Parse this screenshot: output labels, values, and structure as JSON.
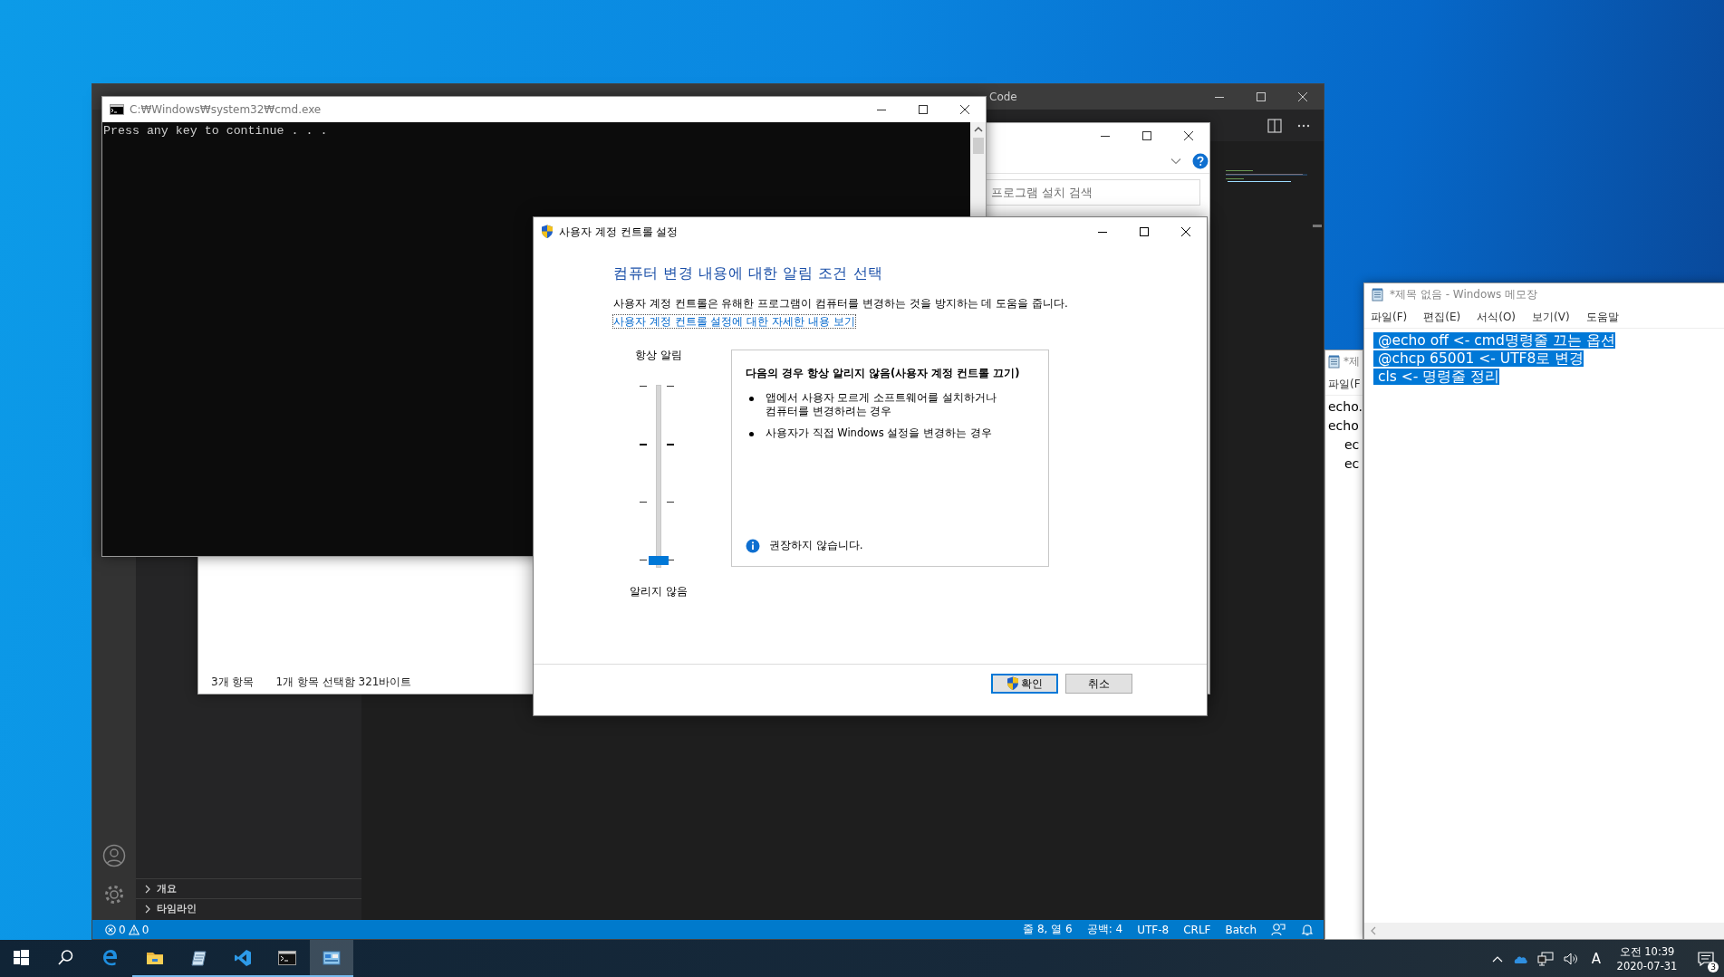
{
  "vscode": {
    "title_fragment": "Code",
    "sidebar_sections": [
      {
        "label": "개요",
        "expanded": false
      },
      {
        "label": "타임라인",
        "expanded": false
      }
    ],
    "status_bar": {
      "errors": "0",
      "warnings": "0",
      "items": [
        "줄 8, 열 6",
        "공백: 4",
        "UTF-8",
        "CRLF",
        "Batch"
      ]
    }
  },
  "explorer": {
    "search": {
      "placeholder": "프로그램 설치 검색"
    },
    "status": [
      "3개 항목",
      "1개 항목 선택함 321바이트"
    ]
  },
  "cmd": {
    "title": "C:₩Windows₩system32₩cmd.exe",
    "output": "Press any key to continue . . ."
  },
  "uac": {
    "title": "사용자 계정 컨트롤 설정",
    "heading": "컴퓨터 변경 내용에 대한 알림 조건 선택",
    "description": "사용자 계정 컨트롤은 유해한 프로그램이 컴퓨터를 변경하는 것을 방지하는 데 도움을 줍니다.",
    "link": "사용자 계정 컨트롤 설정에 대한 자세한 내용 보기",
    "top_label": "항상 알림",
    "bottom_label": "알리지 않음",
    "slider": {
      "level": 0
    },
    "info": {
      "title": "다음의 경우 항상 알리지 않음(사용자 계정 컨트롤 끄기)",
      "bullets": [
        "앱에서 사용자 모르게 소프트웨어를 설치하거나 컴퓨터를 변경하려는 경우",
        "사용자가 직접 Windows 설정을 변경하는 경우"
      ],
      "note": "권장하지 않습니다."
    },
    "buttons": [
      {
        "label": "확인",
        "kind": "shield",
        "default": true
      },
      {
        "label": "취소",
        "kind": "plain",
        "default": false
      }
    ]
  },
  "notepad_back": {
    "title": "*제",
    "menu": [
      "파일(F"
    ],
    "lines": [
      {
        "text": "echo.",
        "indented": false
      },
      {
        "text": "echo",
        "indented": false
      },
      {
        "text": "ec",
        "indented": true
      },
      {
        "text": "ec",
        "indented": true
      }
    ]
  },
  "notepad": {
    "title": "*제목 없음 - Windows 메모장",
    "menu": [
      "파일(F)",
      "편집(E)",
      "서식(O)",
      "보기(V)",
      "도움말"
    ],
    "lines": [
      {
        "text": " @echo off <- cmd명령줄 끄는 옵션",
        "selected": true
      },
      {
        "text": " @chcp 65001 <- UTF8로 변경",
        "selected": true
      },
      {
        "text": " cls <- 명령줄 정리",
        "selected": true
      }
    ]
  },
  "taskbar": {
    "apps": [
      {
        "kind": "start",
        "running": false,
        "selected": false
      },
      {
        "kind": "search",
        "running": false,
        "selected": false
      },
      {
        "kind": "edge",
        "running": false,
        "selected": false
      },
      {
        "kind": "folder",
        "running": true,
        "selected": false
      },
      {
        "kind": "notepad",
        "running": true,
        "selected": false
      },
      {
        "kind": "vscode",
        "running": true,
        "selected": false
      },
      {
        "kind": "terminal",
        "running": true,
        "selected": false
      },
      {
        "kind": "control",
        "running": true,
        "selected": true
      }
    ],
    "ime": "A",
    "time": "오전 10:39",
    "date": "2020-07-31",
    "notifications": "3"
  }
}
